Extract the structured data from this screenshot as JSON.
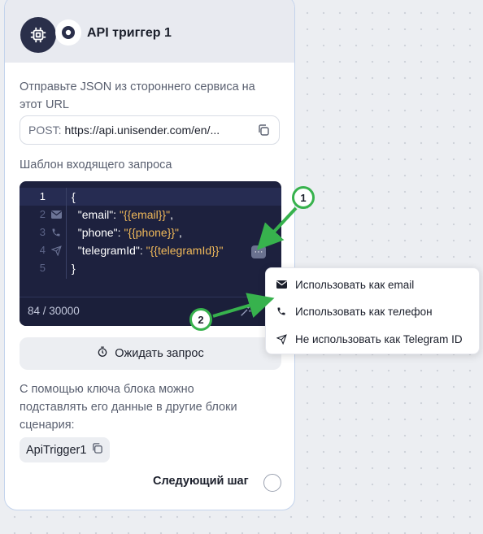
{
  "block": {
    "title": "API триггер 1",
    "description": "Отправьте JSON из стороннего сервиса на этот URL",
    "url": {
      "method": "POST:",
      "value": "https://api.unisender.com/en/..."
    },
    "template_label": "Шаблон входящего запроса",
    "editor": {
      "lines": [
        {
          "number": "1",
          "text": "{"
        },
        {
          "number": "2",
          "key": "\"email\": ",
          "value": "\"{{email}}\"",
          "tail": ","
        },
        {
          "number": "3",
          "key": "\"phone\": ",
          "value": "\"{{phone}}\"",
          "tail": ","
        },
        {
          "number": "4",
          "key": "\"telegramId\": ",
          "value": "\"{{telegramId}}\"",
          "tail": ""
        },
        {
          "number": "5",
          "text": "}"
        }
      ],
      "gutter_icons": [
        "envelope-icon",
        "phone-icon",
        "paper-plane-icon"
      ],
      "more_button": "···",
      "counter": "84 / 30000"
    },
    "wait_button": "Ожидать запрос",
    "key_description": "С помощью ключа блока можно подставлять его данные в другие блоки сценария:",
    "key_value": "ApiTrigger1",
    "next_step": "Следующий шаг"
  },
  "context_menu": {
    "items": [
      {
        "label": "Использовать как email",
        "icon": "envelope-icon"
      },
      {
        "label": "Использовать как телефон",
        "icon": "phone-icon"
      },
      {
        "label": "Не использовать как Telegram ID",
        "icon": "paper-plane-icon"
      }
    ]
  },
  "annotations": [
    {
      "label": "1"
    },
    {
      "label": "2"
    }
  ],
  "colors": {
    "editor_bg": "#1d213e",
    "string_value": "#f0b95a",
    "annotation_green": "#37b24d",
    "header_bg": "#e8eaf0",
    "card_border": "#c3d3ec"
  }
}
